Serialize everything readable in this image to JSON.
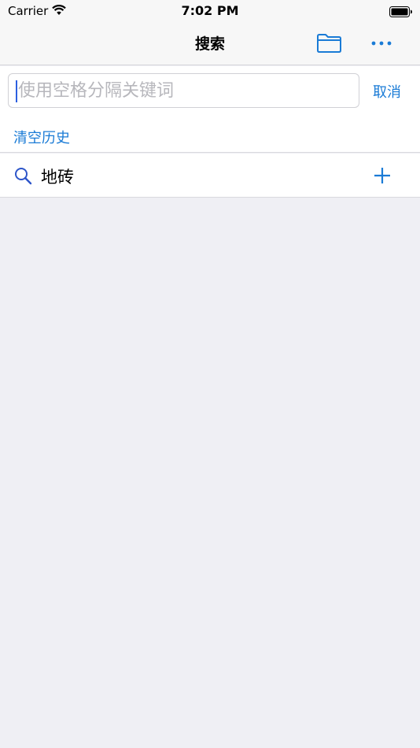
{
  "status_bar": {
    "carrier": "Carrier",
    "time": "7:02 PM",
    "wifi_icon": "wifi-icon",
    "battery_icon": "battery-icon"
  },
  "nav": {
    "title": "搜索",
    "folder_icon": "folder-icon",
    "more_icon": "more-icon"
  },
  "search": {
    "placeholder": "使用空格分隔关键词",
    "value": "",
    "cancel_label": "取消",
    "clear_history_label": "清空历史"
  },
  "history": {
    "items": [
      {
        "text": "地砖",
        "icon": "search-icon",
        "action_icon": "plus-icon"
      }
    ]
  },
  "colors": {
    "accent": "#1a7bd6",
    "background": "#efeff4",
    "bar": "#f7f7f7"
  }
}
